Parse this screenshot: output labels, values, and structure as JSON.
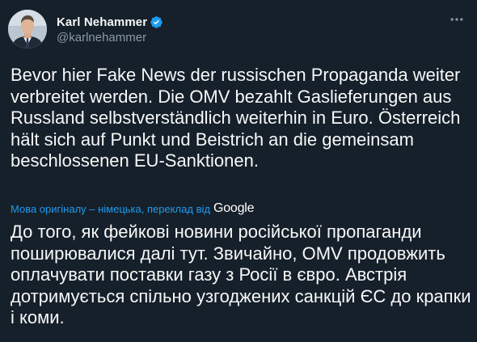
{
  "author": {
    "display_name": "Karl Nehammer",
    "handle": "@karlnehammer",
    "verified": true
  },
  "tweet": {
    "original_text": "Bevor hier Fake News der russischen Propaganda weiter verbreitet werden. Die OMV bezahlt Gaslieferungen aus Russland selbstverständlich weiterhin in Euro. Österreich hält sich auf Punkt und Beistrich an die gemeinsam beschlossenen EU-Sanktionen.",
    "translation_notice": "Мова оригіналу – німецька, переклад від",
    "translation_provider": "Google",
    "translated_text": "До того, як фейкові новини російської пропаганди поширювалися далі тут. Звичайно, OMV продовжить оплачувати поставки газу з Росії в євро. Австрія дотримується спільно узгоджених санкцій ЄС до крапки і коми."
  },
  "icons": {
    "verified": "verified-badge-icon",
    "more": "more-options-icon"
  },
  "colors": {
    "background": "#15202b",
    "text": "#f7f9f9",
    "secondary": "#8b98a5",
    "accent": "#1d9bf0"
  }
}
